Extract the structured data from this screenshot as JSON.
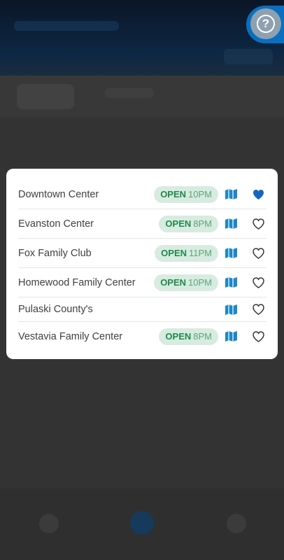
{
  "help": {
    "icon": "help-question-icon",
    "glyph": "?"
  },
  "locations": [
    {
      "name": "Downtown Center",
      "open_label": "OPEN",
      "time": "10PM",
      "has_status": true,
      "favorited": true
    },
    {
      "name": "Evanston Center",
      "open_label": "OPEN",
      "time": "8PM",
      "has_status": true,
      "favorited": false
    },
    {
      "name": "Fox Family Club",
      "open_label": "OPEN",
      "time": "11PM",
      "has_status": true,
      "favorited": false
    },
    {
      "name": "Homewood Family Center",
      "open_label": "OPEN",
      "time": "10PM",
      "has_status": true,
      "favorited": false
    },
    {
      "name": "Pulaski County's",
      "open_label": "",
      "time": "",
      "has_status": false,
      "favorited": false
    },
    {
      "name": "Vestavia Family Center",
      "open_label": "OPEN",
      "time": "8PM",
      "has_status": true,
      "favorited": false
    }
  ],
  "colors": {
    "accent": "#0a6fbf",
    "open_green": "#1e8a4a",
    "badge_bg": "#d8ebe0",
    "heart_filled": "#1565c0"
  }
}
